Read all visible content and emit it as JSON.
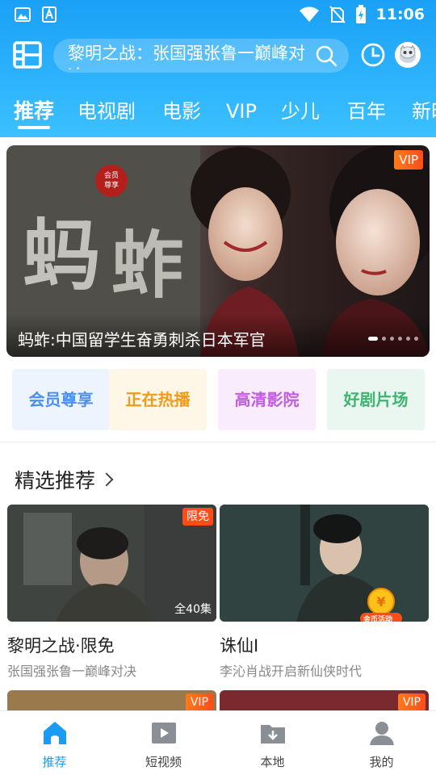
{
  "status_bar": {
    "time": "11:06"
  },
  "search": {
    "text": "黎明之战：张国强张鲁一巅峰对决"
  },
  "tabs": [
    {
      "label": "推荐",
      "active": true
    },
    {
      "label": "电视剧"
    },
    {
      "label": "电影"
    },
    {
      "label": "VIP"
    },
    {
      "label": "少儿"
    },
    {
      "label": "百年"
    },
    {
      "label": "新时"
    }
  ],
  "banner": {
    "badge": "VIP",
    "title": "蚂蚱:中国留学生奋勇刺杀日本军官",
    "poster_text": "蚂蚱",
    "seal_text": "会员尊享",
    "slide_count": 6,
    "active_slide": 1
  },
  "quick_entries": [
    {
      "label": "会员尊享",
      "color": "#4b8ff0",
      "bg": "#eef4fd"
    },
    {
      "label": "正在热播",
      "color": "#f09a1a",
      "bg": "#fef6e6"
    },
    {
      "label": "高清影院",
      "color": "#c45ae6",
      "bg": "#f8ecfd"
    },
    {
      "label": "好剧片场",
      "color": "#3cb56e",
      "bg": "#eaf6f0"
    }
  ],
  "section": {
    "title": "精选推荐"
  },
  "cards": [
    {
      "badge": "限免",
      "episodes": "全40集",
      "title": "黎明之战·限免",
      "subtitle": "张国强张鲁一巅峰对决"
    },
    {
      "coin_badge": "金币活动",
      "title": "诛仙I",
      "subtitle": "李沁肖战开启新仙侠时代"
    }
  ],
  "partial_cards": [
    {
      "badge": "VIP"
    },
    {
      "badge": "VIP"
    }
  ],
  "bottom_nav": [
    {
      "label": "推荐",
      "icon": "home-icon",
      "active": true
    },
    {
      "label": "短视频",
      "icon": "play-video-icon"
    },
    {
      "label": "本地",
      "icon": "download-folder-icon"
    },
    {
      "label": "我的",
      "icon": "person-icon"
    }
  ],
  "colors": {
    "accent": "#1a9cf5",
    "header": "#27aef9",
    "vip": "#ff5a1a"
  }
}
